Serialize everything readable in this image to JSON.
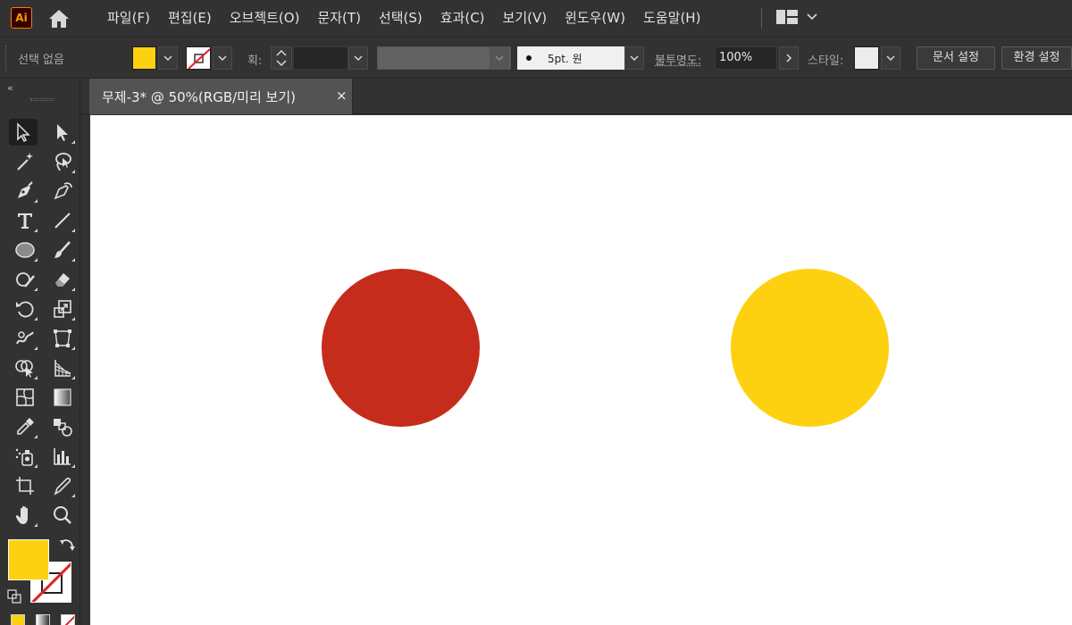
{
  "app": {
    "logo_text": "Ai"
  },
  "menu": {
    "items": [
      "파일(F)",
      "편집(E)",
      "오브젝트(O)",
      "문자(T)",
      "선택(S)",
      "효과(C)",
      "보기(V)",
      "윈도우(W)",
      "도움말(H)"
    ]
  },
  "control_bar": {
    "selection_status": "선택 없음",
    "stroke_label": "획:",
    "brush_value": "5pt. 원",
    "opacity_label": "불투명도:",
    "opacity_value": "100%",
    "style_label": "스타일:",
    "document_setup_button": "문서 설정",
    "preferences_button": "환경 설정"
  },
  "colors": {
    "fill": "#fdd110",
    "circle_left": "#c52c1b",
    "circle_right": "#fdd110",
    "none_slash": "#e02020"
  },
  "toolbar": {
    "collapse_glyph": "«",
    "tools": [
      "selection-tool",
      "direct-selection-tool",
      "magic-wand-tool",
      "lasso-tool",
      "pen-tool",
      "curvature-tool",
      "type-tool",
      "line-segment-tool",
      "ellipse-tool",
      "paintbrush-tool",
      "shaper-tool",
      "eraser-tool",
      "rotate-tool",
      "scale-tool",
      "warp-tool",
      "free-transform-tool",
      "shape-builder-tool",
      "perspective-grid-tool",
      "mesh-tool",
      "gradient-tool",
      "eyedropper-tool",
      "blend-tool",
      "symbol-sprayer-tool",
      "column-graph-tool",
      "artboard-tool",
      "slice-tool",
      "hand-tool",
      "zoom-tool"
    ]
  },
  "document": {
    "tab_title": "무제-3* @ 50%(RGB/미리 보기)",
    "close_glyph": "×"
  }
}
